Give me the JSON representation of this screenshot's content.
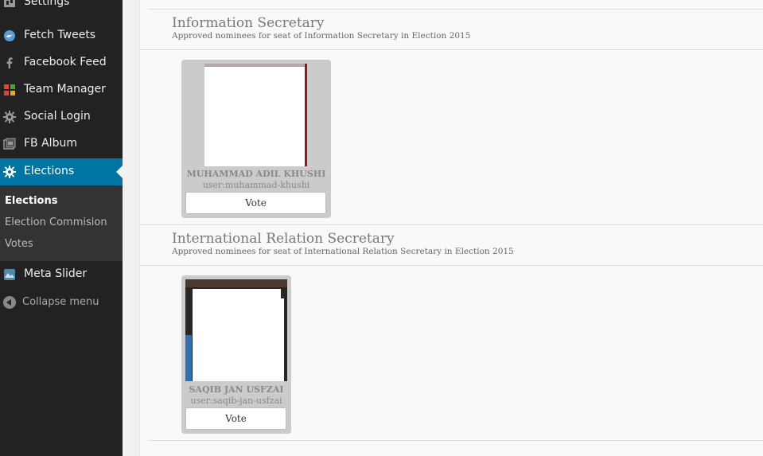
{
  "sidebar": {
    "items": [
      {
        "label": "Settings",
        "icon": "settings-icon"
      },
      {
        "label": "Fetch Tweets",
        "icon": "twitter-icon"
      },
      {
        "label": "Facebook Feed",
        "icon": "facebook-icon"
      },
      {
        "label": "Team Manager",
        "icon": "grid-icon"
      },
      {
        "label": "Social Login",
        "icon": "gear-icon"
      },
      {
        "label": "FB Album",
        "icon": "album-icon"
      },
      {
        "label": "Elections",
        "icon": "gear-icon"
      },
      {
        "label": "Meta Slider",
        "icon": "slider-icon"
      }
    ],
    "submenu": [
      "Elections",
      "Election Commision",
      "Votes"
    ],
    "collapse_label": "Collapse menu",
    "active_color": "#0074a2"
  },
  "sections": [
    {
      "title": "Information Secretary",
      "description": "Approved nominees for seat of Information Secretary in Election 2015",
      "candidates": [
        {
          "name": "MUHAMMAD ADIL KHUSHI",
          "user": "user:muhammad-khushi",
          "vote_label": "Vote"
        }
      ]
    },
    {
      "title": "International Relation Secretary",
      "description": "Approved nominees for seat of International Relation Secretary in Election 2015",
      "candidates": [
        {
          "name": "SAQIB JAN USFZAI",
          "user": "user:saqib-jan-usfzai",
          "vote_label": "Vote"
        }
      ]
    }
  ]
}
